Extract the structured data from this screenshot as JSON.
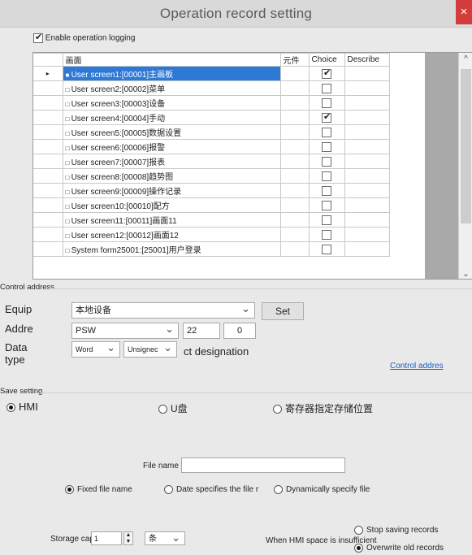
{
  "window": {
    "title": "Operation record setting",
    "close_glyph": "×"
  },
  "enable_logging": {
    "label": "Enable operation logging",
    "checked": true
  },
  "grid": {
    "headers": {
      "name": "画面",
      "element": "元件",
      "choice": "Choice",
      "describe": "Describe"
    },
    "rows": [
      {
        "name": "User screen1:[00001]主画板",
        "choice": true
      },
      {
        "name": "User screen2:[00002]菜单",
        "choice": false
      },
      {
        "name": "User screen3:[00003]设备",
        "choice": false
      },
      {
        "name": "User screen4:[00004]手动",
        "choice": true
      },
      {
        "name": "User screen5:[00005]数据设置",
        "choice": false
      },
      {
        "name": "User screen6:[00006]报警",
        "choice": false
      },
      {
        "name": "User screen7:[00007]报表",
        "choice": false
      },
      {
        "name": "User screen8:[00008]趋势图",
        "choice": false
      },
      {
        "name": "User screen9:[00009]操作记录",
        "choice": false
      },
      {
        "name": "User screen10:[00010]配方",
        "choice": false
      },
      {
        "name": "User screen11:[00011]画面11",
        "choice": false
      },
      {
        "name": "User screen12:[00012]画面12",
        "choice": false
      },
      {
        "name": "System form25001:[25001]用户登录",
        "choice": false
      }
    ],
    "scroll_up": "^",
    "scroll_down": "⌄",
    "row_marker": "▸"
  },
  "control_address": {
    "group_label": "Control address",
    "equip_label": "Equip",
    "equip_value": "本地设备",
    "set_button": "Set",
    "addre_label": "Addre",
    "addre_value": "PSW",
    "addre_num": "22",
    "addre_num2": "0",
    "data_type_label": "Data type",
    "data_type_value": "Word",
    "data_sign_value": "Unsignec",
    "designation_text": "ct designation",
    "link_text": "Control addres"
  },
  "save_setting": {
    "group_label": "Save setting",
    "opt_hmi": "HMI",
    "opt_u": "U盘",
    "opt_register": "寄存器指定存储位置",
    "file_name_label": "File name",
    "file_name_value": "",
    "fixed_name": "Fixed file name",
    "date_name": "Date specifies the file r",
    "dynamic_name": "Dynamically specify file",
    "storage_label": "Storage capacity",
    "storage_value": "1",
    "storage_unit": "条",
    "insufficient_label": "When HMI space is insufficient",
    "stop_records": "Stop saving records",
    "overwrite_records": "Overwrite old records"
  }
}
